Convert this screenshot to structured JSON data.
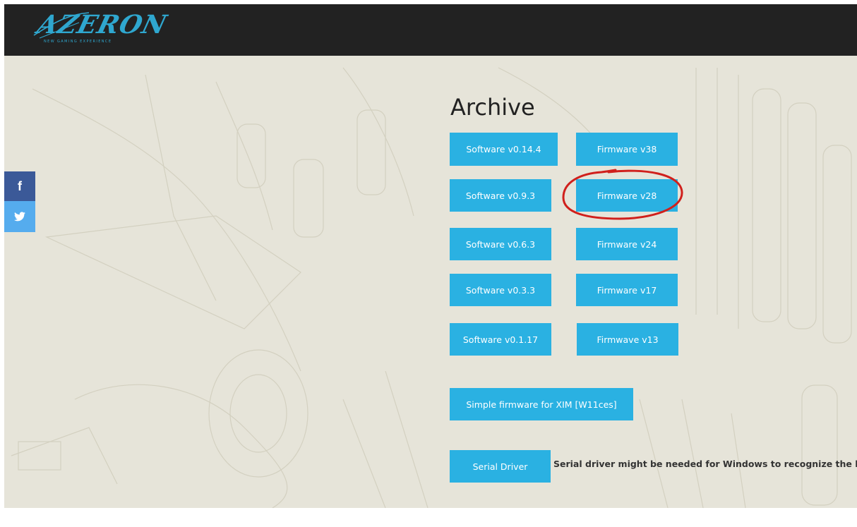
{
  "header": {
    "logo_text": "AZERON",
    "logo_tagline": "NEW GAMING EXPERIENCE"
  },
  "share": {
    "facebook_glyph": "f",
    "twitter_glyph": "🐦"
  },
  "archive": {
    "title": "Archive",
    "software": [
      "Software v0.14.4",
      "Software v0.9.3",
      "Software v0.6.3",
      "Software v0.3.3",
      "Software v0.1.17"
    ],
    "firmware": [
      "Firmware v38",
      "Firmware v28",
      "Firmware v24",
      "Firmware v17",
      "Firmwave v13"
    ],
    "xim_button": "Simple firmware for XIM [W11ces]",
    "serial_button": "Serial Driver",
    "serial_note": "Serial driver might be needed for Windows to recognize the key"
  },
  "colors": {
    "topbar": "#222222",
    "background": "#e6e4d9",
    "button": "#2ab1e2",
    "facebook": "#3b5998",
    "twitter": "#55acee",
    "annotation": "#d0201c"
  }
}
